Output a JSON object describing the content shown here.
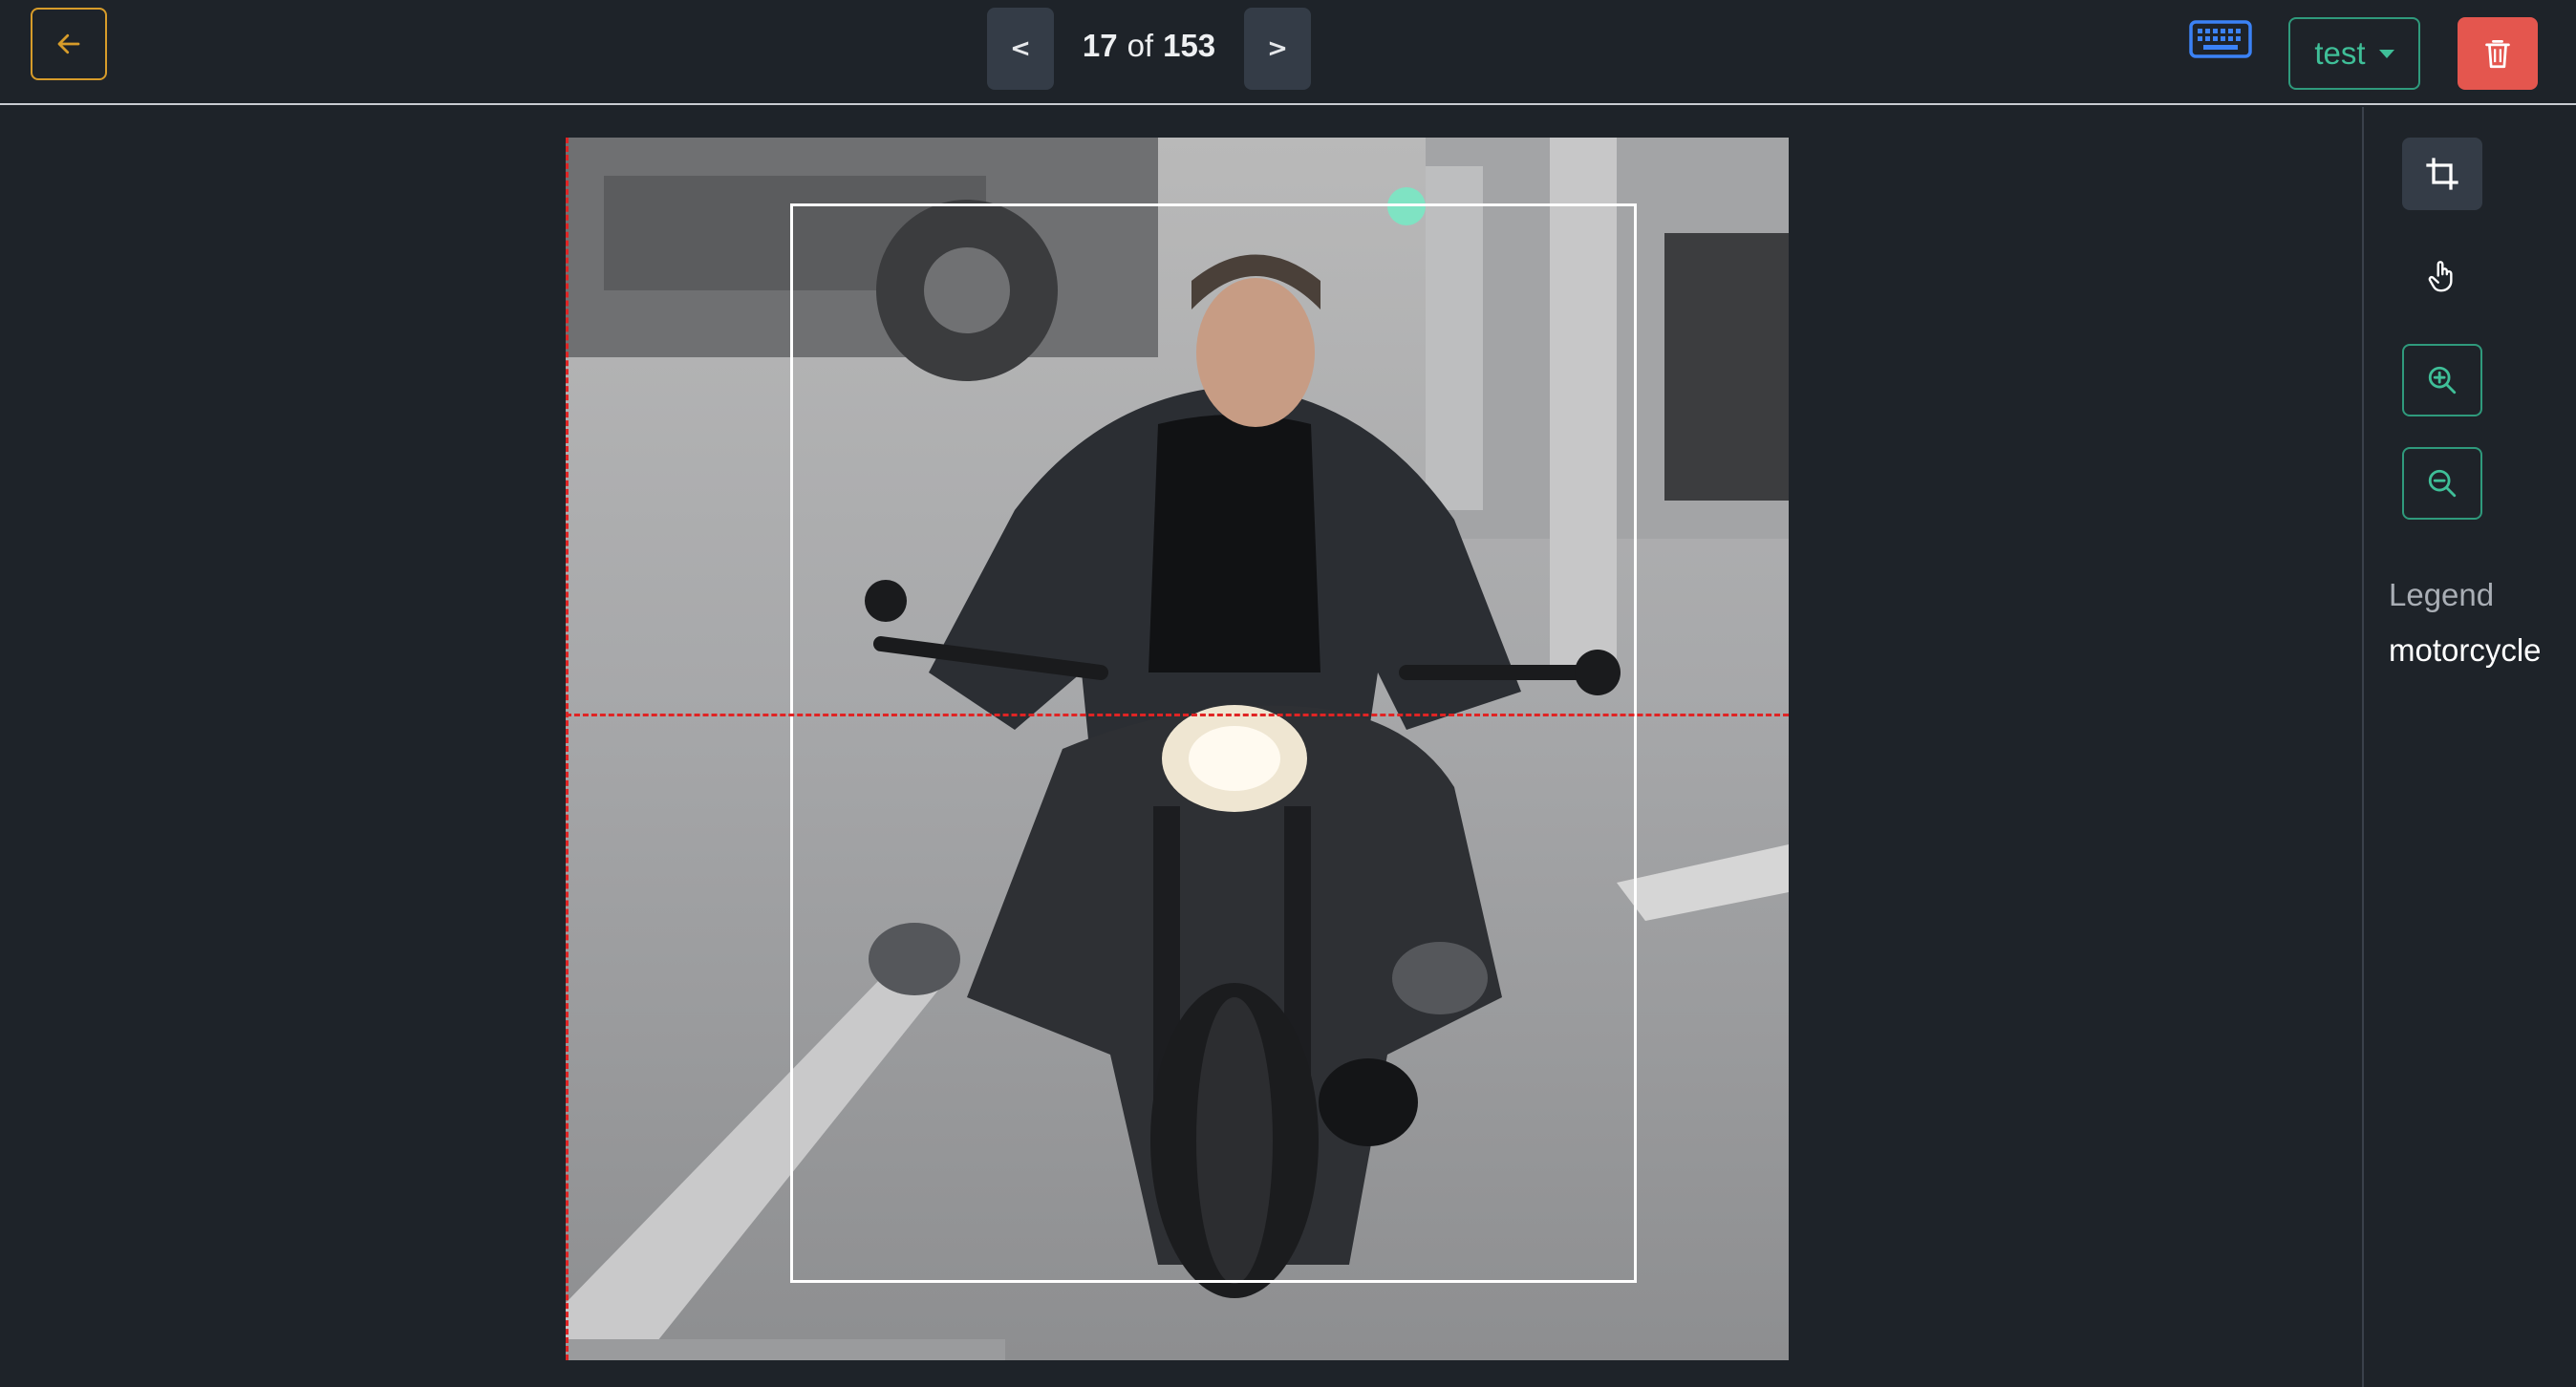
{
  "header": {
    "prev_label": "<",
    "next_label": ">",
    "current_index": "17",
    "of_text": "of",
    "total_count": "153",
    "dataset_label": "test"
  },
  "icons": {
    "back": "arrow-left-icon",
    "keyboard": "keyboard-icon",
    "dataset_caret": "caret-down-icon",
    "delete": "trash-icon",
    "crop": "crop-icon",
    "pan": "hand-pointer-icon",
    "zoom_in": "zoom-in-icon",
    "zoom_out": "zoom-out-icon"
  },
  "colors": {
    "background": "#1e2329",
    "back_border": "#d79c2a",
    "accent_green": "#2f9a7c",
    "delete_red": "#e4564e",
    "keyboard_blue": "#3b82f6",
    "guide_red": "#e02424",
    "bbox_white": "#ffffff"
  },
  "annotation": {
    "label": "motorcycle"
  },
  "legend": {
    "title": "Legend",
    "items": [
      "motorcycle"
    ]
  }
}
